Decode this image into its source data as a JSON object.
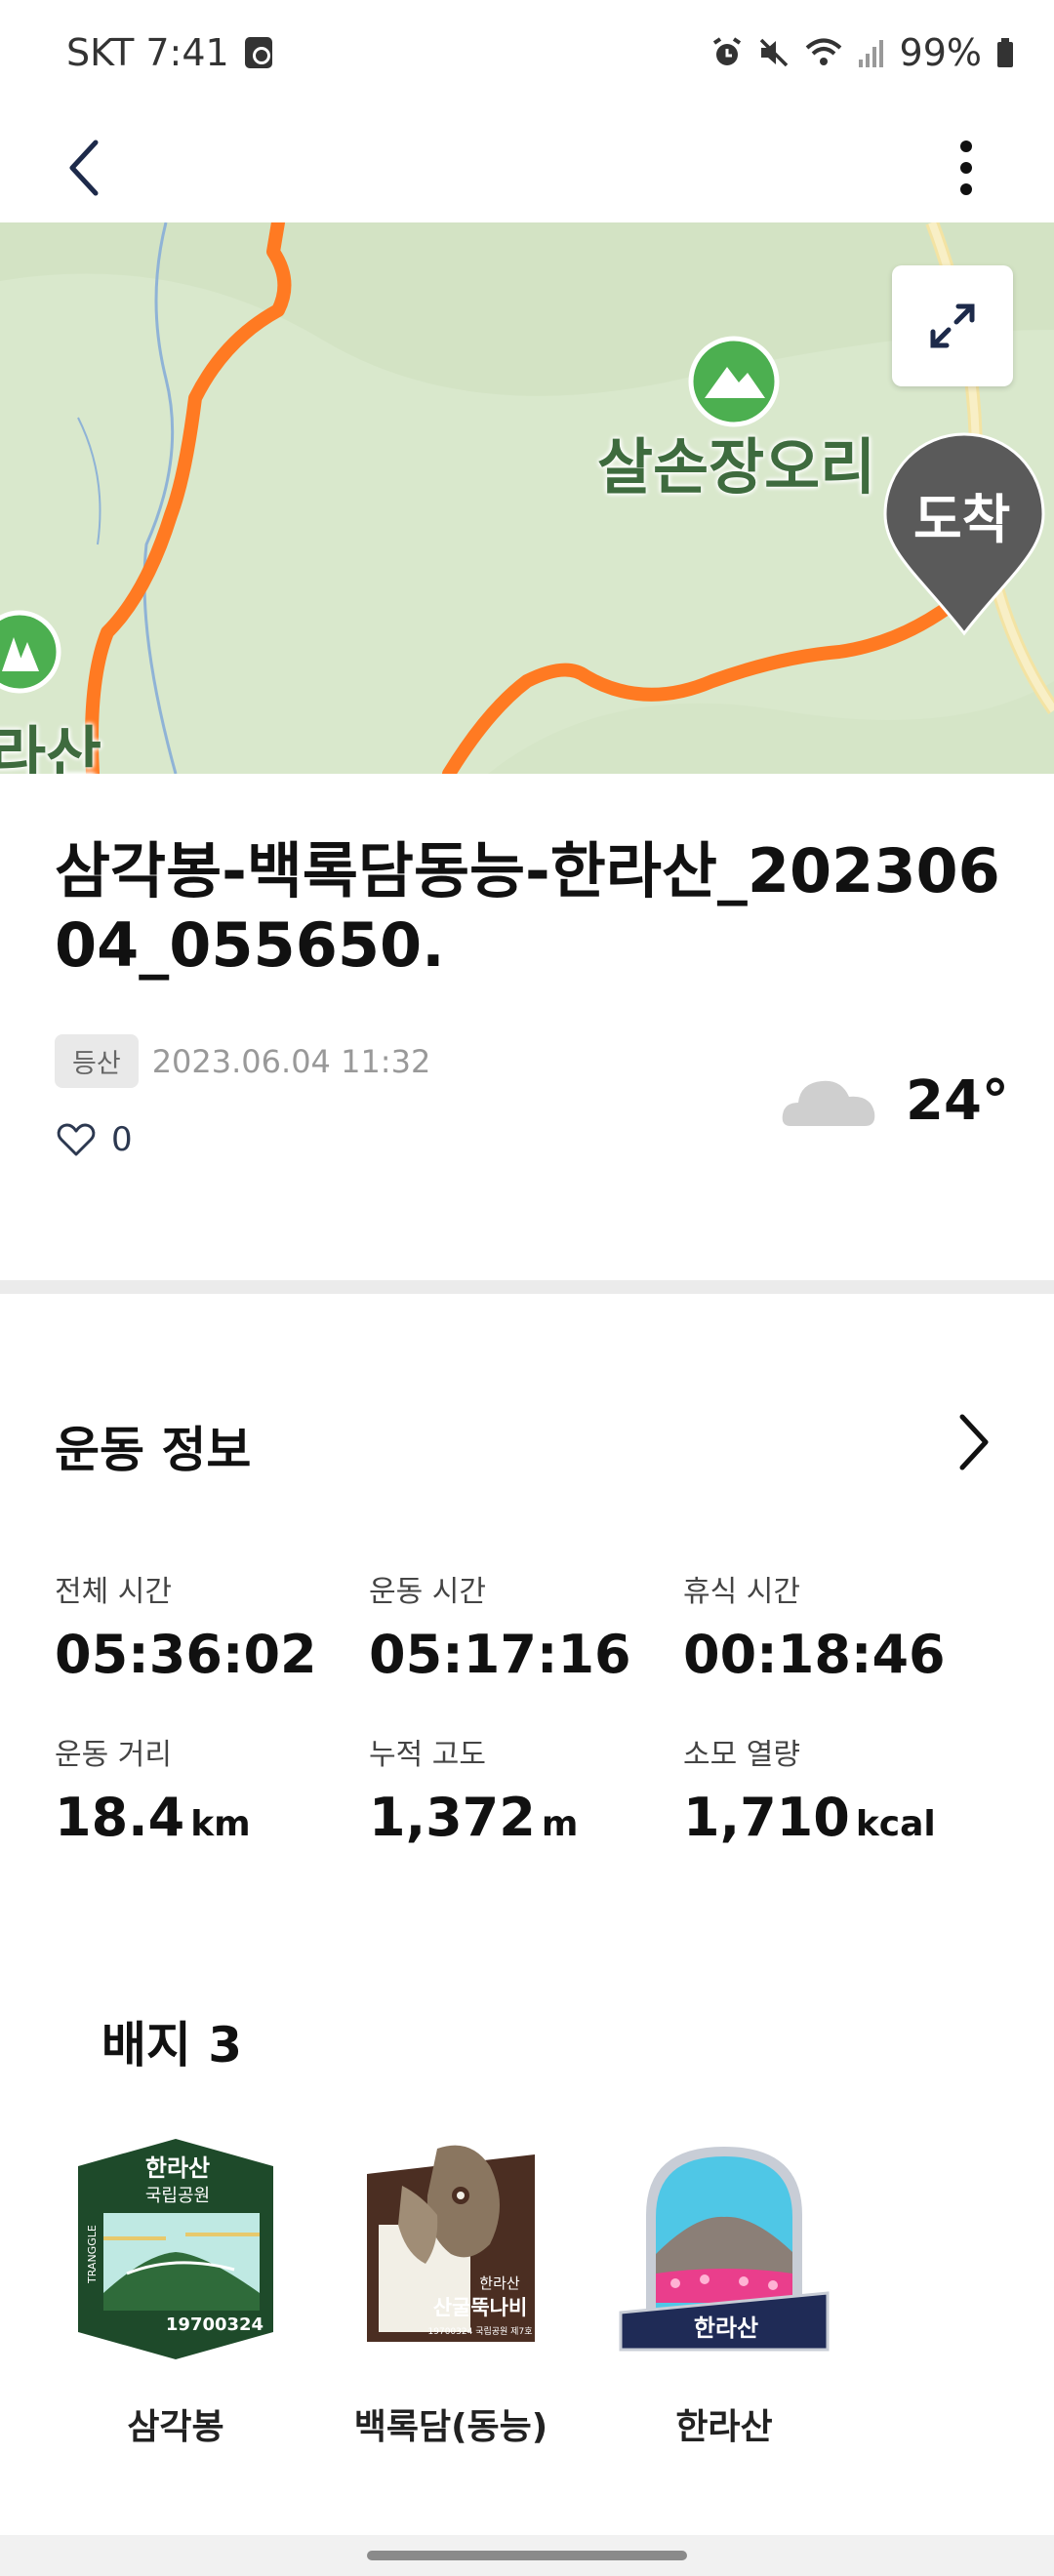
{
  "status_bar": {
    "carrier_time": "SKT 7:41",
    "battery": "99%",
    "icons": [
      "alarm-icon",
      "mute-icon",
      "wifi-icon",
      "signal-icon",
      "battery-icon"
    ]
  },
  "header": {
    "back_icon": "chevron-left-icon",
    "more_icon": "more-vertical-icon"
  },
  "map": {
    "peak_label": "살손장오리",
    "left_label": "라산",
    "arrival_label": "도착",
    "expand_icon": "expand-icon",
    "route_color": "#ff7a22"
  },
  "record": {
    "title": "삼각봉-백록담동능-한라산_20230604_055650.",
    "category": "등산",
    "datetime": "2023.06.04 11:32",
    "likes": "0",
    "temperature": "24°",
    "weather_icon": "cloud-icon"
  },
  "exercise": {
    "title": "운동 정보",
    "stats": [
      {
        "label": "전체 시간",
        "value": "05:36:02",
        "unit": ""
      },
      {
        "label": "운동 시간",
        "value": "05:17:16",
        "unit": ""
      },
      {
        "label": "휴식 시간",
        "value": "00:18:46",
        "unit": ""
      },
      {
        "label": "운동 거리",
        "value": "18.4",
        "unit": "km"
      },
      {
        "label": "누적 고도",
        "value": "1,372",
        "unit": "m"
      },
      {
        "label": "소모 열량",
        "value": "1,710",
        "unit": "kcal"
      }
    ]
  },
  "badges": {
    "title": "배지 3",
    "items": [
      {
        "name": "삼각봉",
        "art_lines": [
          "한라산",
          "국립공원",
          "19700324",
          "TRANGGLE"
        ]
      },
      {
        "name": "백록담(동능)",
        "art_lines": [
          "한라산",
          "산굴뚝나비",
          "19700324 국립공원 제7호"
        ]
      },
      {
        "name": "한라산",
        "art_lines": [
          "한라산"
        ]
      }
    ]
  }
}
